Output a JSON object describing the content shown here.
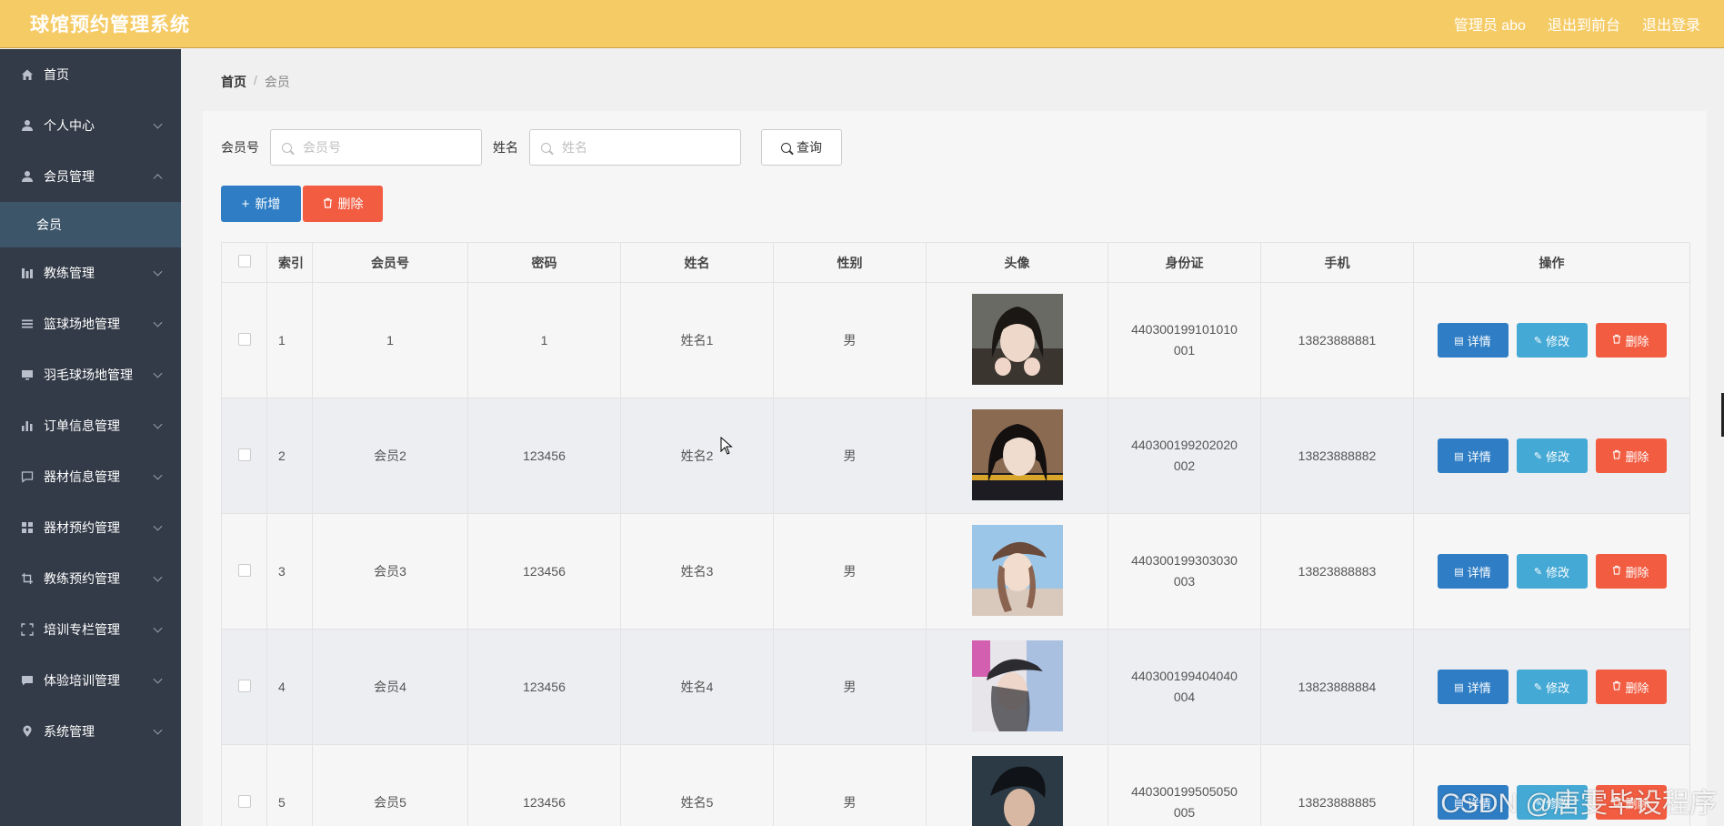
{
  "header": {
    "title": "球馆预约管理系统",
    "admin": "管理员 abo",
    "to_front": "退出到前台",
    "logout": "退出登录"
  },
  "sidebar": {
    "items": [
      {
        "label": "首页",
        "icon": "home-icon"
      },
      {
        "label": "个人中心",
        "icon": "user-icon"
      },
      {
        "label": "会员管理",
        "icon": "user-icon",
        "expanded": true
      },
      {
        "label": "教练管理",
        "icon": "chart-icon"
      },
      {
        "label": "篮球场地管理",
        "icon": "list-icon"
      },
      {
        "label": "羽毛球场地管理",
        "icon": "monitor-icon"
      },
      {
        "label": "订单信息管理",
        "icon": "bar-chart-icon"
      },
      {
        "label": "器材信息管理",
        "icon": "message-icon"
      },
      {
        "label": "器材预约管理",
        "icon": "grid-icon"
      },
      {
        "label": "教练预约管理",
        "icon": "crop-icon"
      },
      {
        "label": "培训专栏管理",
        "icon": "fullscreen-icon"
      },
      {
        "label": "体验培训管理",
        "icon": "chat-icon"
      },
      {
        "label": "系统管理",
        "icon": "location-icon"
      }
    ],
    "submenu": {
      "label": "会员"
    }
  },
  "breadcrumb": {
    "home": "首页",
    "separator": "/",
    "current": "会员"
  },
  "search": {
    "member_label": "会员号",
    "member_placeholder": "会员号",
    "name_label": "姓名",
    "name_placeholder": "姓名",
    "query_label": "查询"
  },
  "actions": {
    "add": "新增",
    "delete": "删除"
  },
  "table": {
    "headers": [
      "索引",
      "会员号",
      "密码",
      "姓名",
      "性别",
      "头像",
      "身份证",
      "手机",
      "操作"
    ],
    "rows": [
      {
        "index": "1",
        "member_no": "1",
        "password": "1",
        "name": "姓名1",
        "gender": "男",
        "idcard": "440300199101010001",
        "phone": "13823888881"
      },
      {
        "index": "2",
        "member_no": "会员2",
        "password": "123456",
        "name": "姓名2",
        "gender": "男",
        "idcard": "440300199202020002",
        "phone": "13823888882"
      },
      {
        "index": "3",
        "member_no": "会员3",
        "password": "123456",
        "name": "姓名3",
        "gender": "男",
        "idcard": "440300199303030003",
        "phone": "13823888883"
      },
      {
        "index": "4",
        "member_no": "会员4",
        "password": "123456",
        "name": "姓名4",
        "gender": "男",
        "idcard": "440300199404040004",
        "phone": "13823888884"
      },
      {
        "index": "5",
        "member_no": "会员5",
        "password": "123456",
        "name": "姓名5",
        "gender": "男",
        "idcard": "440300199505050005",
        "phone": "13823888885"
      }
    ],
    "ops": {
      "detail": "详情",
      "edit": "修改",
      "delete": "删除"
    }
  },
  "watermark": "CSDN @唐雯毕设程序",
  "colors": {
    "header": "#f5cb66",
    "sidebar": "#333b48",
    "primary": "#2f7ec5",
    "info": "#45a9d5",
    "danger": "#f25c41"
  }
}
